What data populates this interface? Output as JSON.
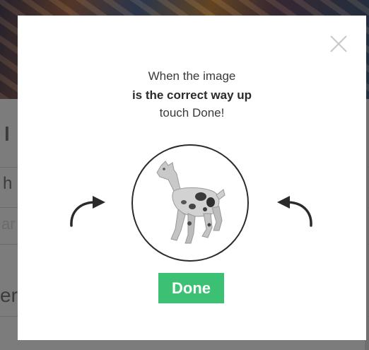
{
  "background": {
    "fragments": [
      "l",
      "h",
      "ar",
      "er"
    ]
  },
  "dialog": {
    "instruction_line1": "When the image",
    "instruction_line2": "is the correct way up",
    "instruction_line3": "touch Done!",
    "done_label": "Done",
    "close_icon": "close-x-icon",
    "rotate_left_icon": "rotate-counterclockwise-arrow-icon",
    "rotate_right_icon": "rotate-clockwise-arrow-icon",
    "image_subject": "toy-llama-figurine"
  },
  "colors": {
    "overlay": "#7d7d7d",
    "dialog_background": "#ffffff",
    "done_button": "#3cc174",
    "done_text": "#ffffff",
    "text": "#3a3a3a",
    "close_icon": "#c8c8c8",
    "arrows": "#2b2b2b"
  }
}
